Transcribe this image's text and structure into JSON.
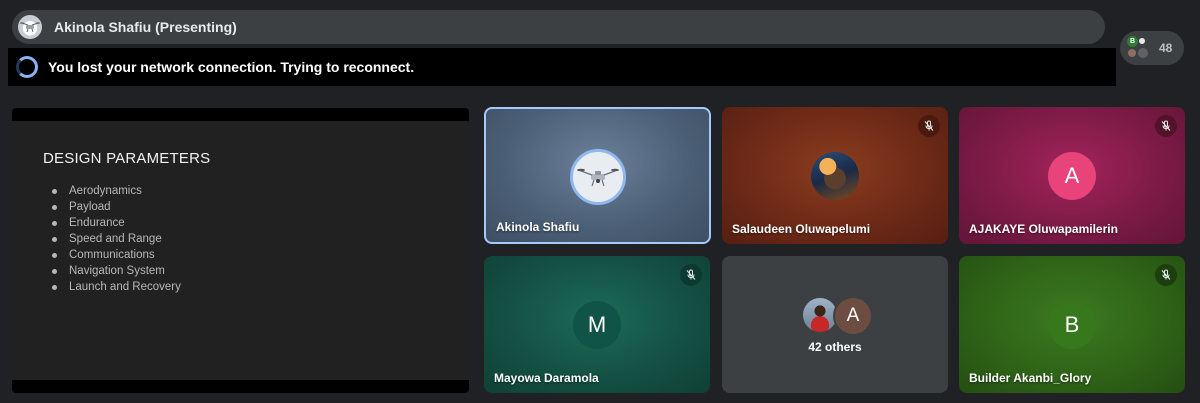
{
  "header": {
    "presenting_label": "Akinola Shafiu (Presenting)",
    "presenter_avatar_icon": "drone-icon"
  },
  "banner": {
    "message": "You lost your network connection. Trying to reconnect.",
    "icon": "spinner-icon"
  },
  "participants": {
    "count": "48",
    "mini_avatar_initials": [
      "B",
      "A"
    ]
  },
  "slide": {
    "title": "DESIGN PARAMETERS",
    "bullets": [
      "Aerodynamics",
      "Payload",
      "Endurance",
      "Speed and Range",
      "Communications",
      "Navigation System",
      "Launch and Recovery"
    ]
  },
  "tiles": [
    {
      "name": "Akinola Shafiu",
      "avatar": "drone-photo",
      "muted": false,
      "active_speaker": true
    },
    {
      "name": "Salaudeen Oluwapelumi",
      "avatar": "photo",
      "muted": true
    },
    {
      "name": "AJAKAYE Oluwapamilerin",
      "initial": "A",
      "avatar_color": "#e8437a",
      "muted": true
    },
    {
      "name": "Mayowa Daramola",
      "initial": "M",
      "avatar_color": "#0f5446",
      "muted": true
    },
    {
      "others_label": "42 others",
      "initial": "A"
    },
    {
      "name": "Builder Akanbi_Glory",
      "initial": "B",
      "avatar_color": "#37781c",
      "muted": true
    }
  ],
  "colors": {
    "background": "#202124",
    "accent": "#8ab4f8",
    "active_border": "#a8c7fa"
  }
}
